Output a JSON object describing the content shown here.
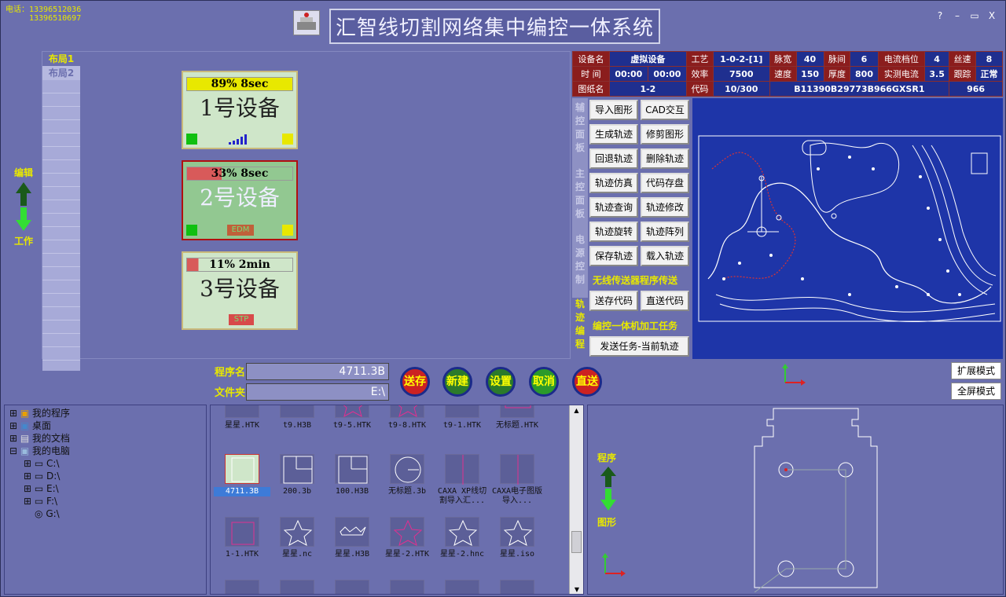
{
  "phone": {
    "label": "电话：13396512036",
    "line2": "13396510697"
  },
  "app_title": "汇智线切割网络集中编控一体系统",
  "window_buttons": [
    "?",
    "–",
    "▭",
    "X"
  ],
  "left_mode": {
    "edit": "编辑",
    "work": "工作"
  },
  "layout_tabs": [
    "布局1",
    "布局2"
  ],
  "devices": [
    {
      "status": "89% 8sec",
      "name": "1号设备",
      "badge": ""
    },
    {
      "status": "33% 8sec",
      "name": "2号设备",
      "badge": "EDM"
    },
    {
      "status": "11% 2min",
      "name": "3号设备",
      "badge": "STP"
    }
  ],
  "info": {
    "device_name_label": "设备名",
    "device_name": "虚拟设备",
    "craft_label": "工艺",
    "craft": "1-0-2-[1]",
    "pulse_width_label": "脉宽",
    "pulse_width": "40",
    "pulse_gap_label": "脉间",
    "pulse_gap": "6",
    "current_level_label": "电流档位",
    "current_level": "4",
    "wire_speed_label": "丝速",
    "wire_speed": "8",
    "time_label": "时  间",
    "time_a": "00:00",
    "time_b": "00:00",
    "efficiency_label": "效率",
    "efficiency": "7500",
    "speed_label": "速度",
    "speed": "150",
    "thickness_label": "厚度",
    "thickness": "800",
    "measured_current_label": "实测电流",
    "measured_current": "3.5",
    "tracking_label": "跟踪",
    "tracking": "正常",
    "drawing_label": "图纸名",
    "drawing": "1-2",
    "code_label": "代码",
    "code": "10/300",
    "code_string": "B11390B29773B966GXSR1",
    "code_num": "966"
  },
  "side_tabs": [
    "辅控面板",
    "主控面板",
    "电源控制",
    "轨迹编程"
  ],
  "tool_buttons": [
    [
      "导入图形",
      "CAD交互"
    ],
    [
      "生成轨迹",
      "修剪图形"
    ],
    [
      "回退轨迹",
      "删除轨迹"
    ],
    [
      "轨迹仿真",
      "代码存盘"
    ],
    [
      "轨迹查询",
      "轨迹修改"
    ],
    [
      "轨迹旋转",
      "轨迹阵列"
    ],
    [
      "保存轨迹",
      "载入轨迹"
    ]
  ],
  "wireless_label": "无线传送器程序传送",
  "wireless_buttons": [
    "送存代码",
    "直送代码"
  ],
  "task_label": "编控一体机加工任务",
  "task_button": "发送任务-当前轨迹",
  "program": {
    "name_label": "程序名",
    "name": "4711.3B",
    "folder_label": "文件夹",
    "folder": "E:\\"
  },
  "round_buttons": [
    "送存",
    "新建",
    "设置",
    "取消",
    "直送"
  ],
  "mode_buttons": [
    "扩展模式",
    "全屏模式"
  ],
  "tree": {
    "items": [
      "我的程序",
      "桌面",
      "我的文档",
      "我的电脑"
    ],
    "drives": [
      "C:\\",
      "D:\\",
      "E:\\",
      "F:\\",
      "G:\\"
    ]
  },
  "files_row1": [
    "星星.HTK",
    "t9.H3B",
    "t9-5.HTK",
    "t9-8.HTK",
    "t9-1.HTK",
    "无标题.HTK"
  ],
  "files_row2": [
    "4711.3B",
    "200.3b",
    "100.H3B",
    "无标题.3b",
    "CAXA XP线切割导入汇...",
    "CAXA电子图版导入..."
  ],
  "files_row3": [
    "1-1.HTK",
    "星星.nc",
    "星星.H3B",
    "星星-2.HTK",
    "星星-2.hnc",
    "星星.iso"
  ],
  "right_mode": {
    "program": "程序",
    "graphic": "图形"
  },
  "colors": {
    "bg": "#6b6fae",
    "canvas": "#1e35a8",
    "accent_yellow": "#e8e800",
    "label_red": "#8b1d1d",
    "value_blue": "#1f2f8f"
  }
}
